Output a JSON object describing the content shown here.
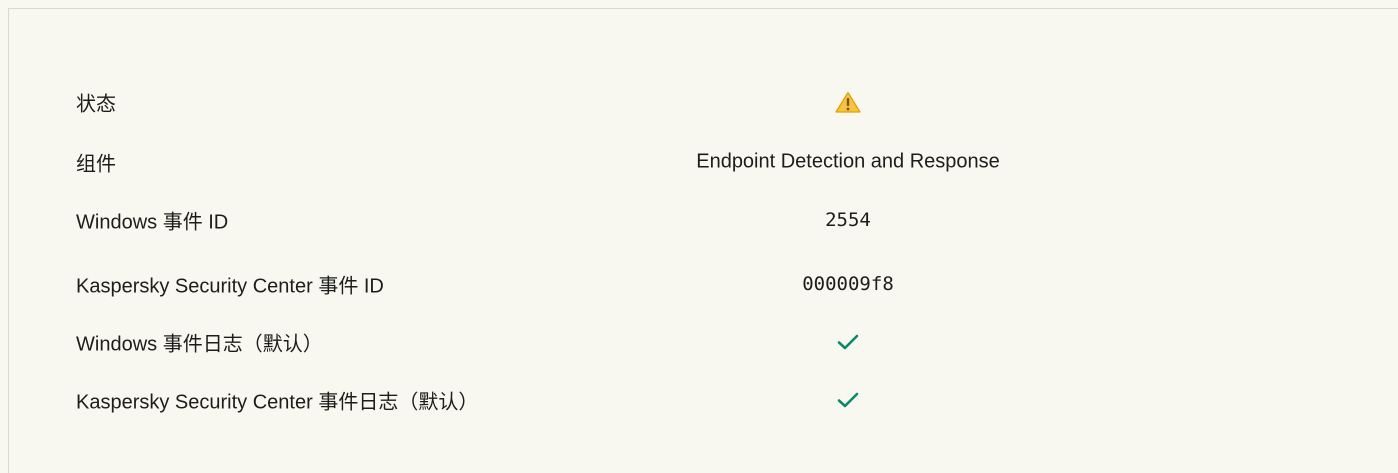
{
  "rows": [
    {
      "label": "状态",
      "value": "",
      "icon": "warning-icon",
      "color": "#f4b400"
    },
    {
      "label": "组件",
      "value": "Endpoint Detection and Response"
    },
    {
      "label": "Windows 事件 ID",
      "value": "2554"
    },
    {
      "label": "Kaspersky Security Center 事件 ID",
      "value": "000009f8"
    },
    {
      "label": "Windows 事件日志（默认）",
      "value": "",
      "icon": "checkmark-icon",
      "color": "#0a8a6a"
    },
    {
      "label": "Kaspersky Security Center 事件日志（默认）",
      "value": "",
      "icon": "checkmark-icon",
      "color": "#0a8a6a"
    }
  ]
}
